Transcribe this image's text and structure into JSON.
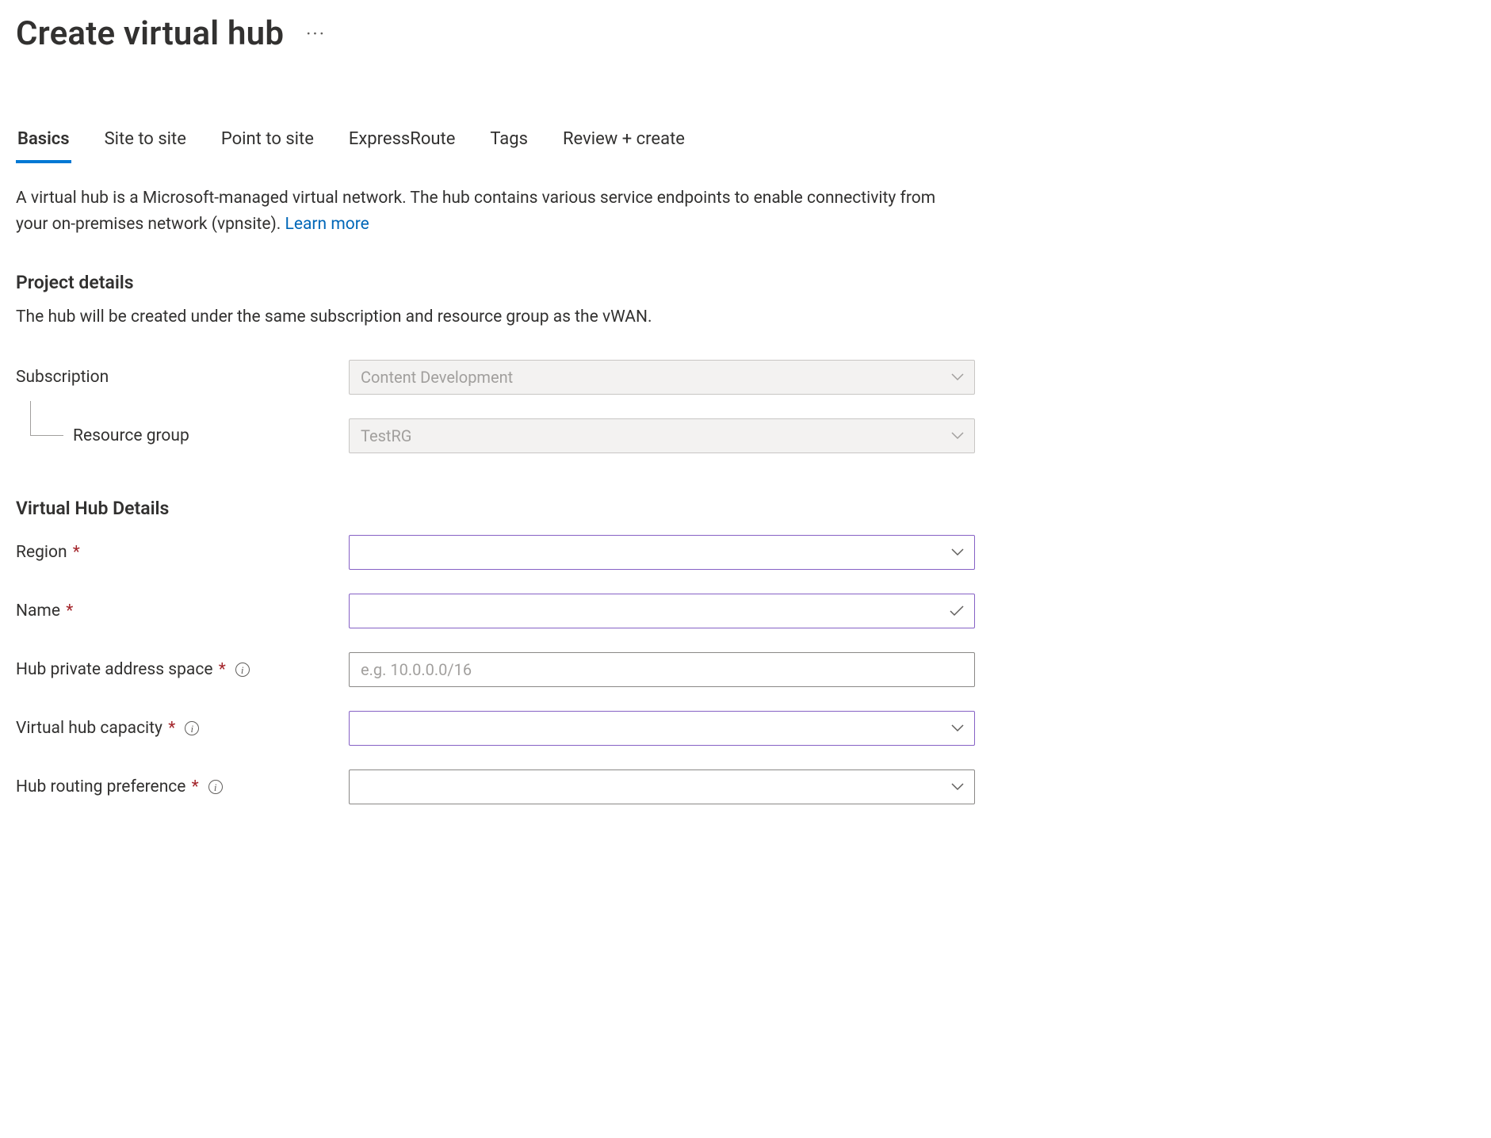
{
  "header": {
    "title": "Create virtual hub",
    "more_label": "···"
  },
  "tabs": [
    {
      "label": "Basics",
      "active": true
    },
    {
      "label": "Site to site",
      "active": false
    },
    {
      "label": "Point to site",
      "active": false
    },
    {
      "label": "ExpressRoute",
      "active": false
    },
    {
      "label": "Tags",
      "active": false
    },
    {
      "label": "Review + create",
      "active": false
    }
  ],
  "description": {
    "text": "A virtual hub is a Microsoft-managed virtual network. The hub contains various service endpoints to enable connectivity from your on-premises network (vpnsite).  ",
    "link_text": "Learn more"
  },
  "project": {
    "heading": "Project details",
    "text": "The hub will be created under the same subscription and resource group as the vWAN.",
    "fields": {
      "subscription": {
        "label": "Subscription",
        "value": "Content Development"
      },
      "resource_group": {
        "label": "Resource group",
        "value": "TestRG"
      }
    }
  },
  "hub": {
    "heading": "Virtual Hub Details",
    "fields": {
      "region": {
        "label": "Region",
        "value": ""
      },
      "name": {
        "label": "Name",
        "value": ""
      },
      "address_space": {
        "label": "Hub private address space",
        "placeholder": "e.g. 10.0.0.0/16",
        "value": ""
      },
      "capacity": {
        "label": "Virtual hub capacity",
        "value": ""
      },
      "routing_pref": {
        "label": "Hub routing preference",
        "value": ""
      }
    }
  }
}
